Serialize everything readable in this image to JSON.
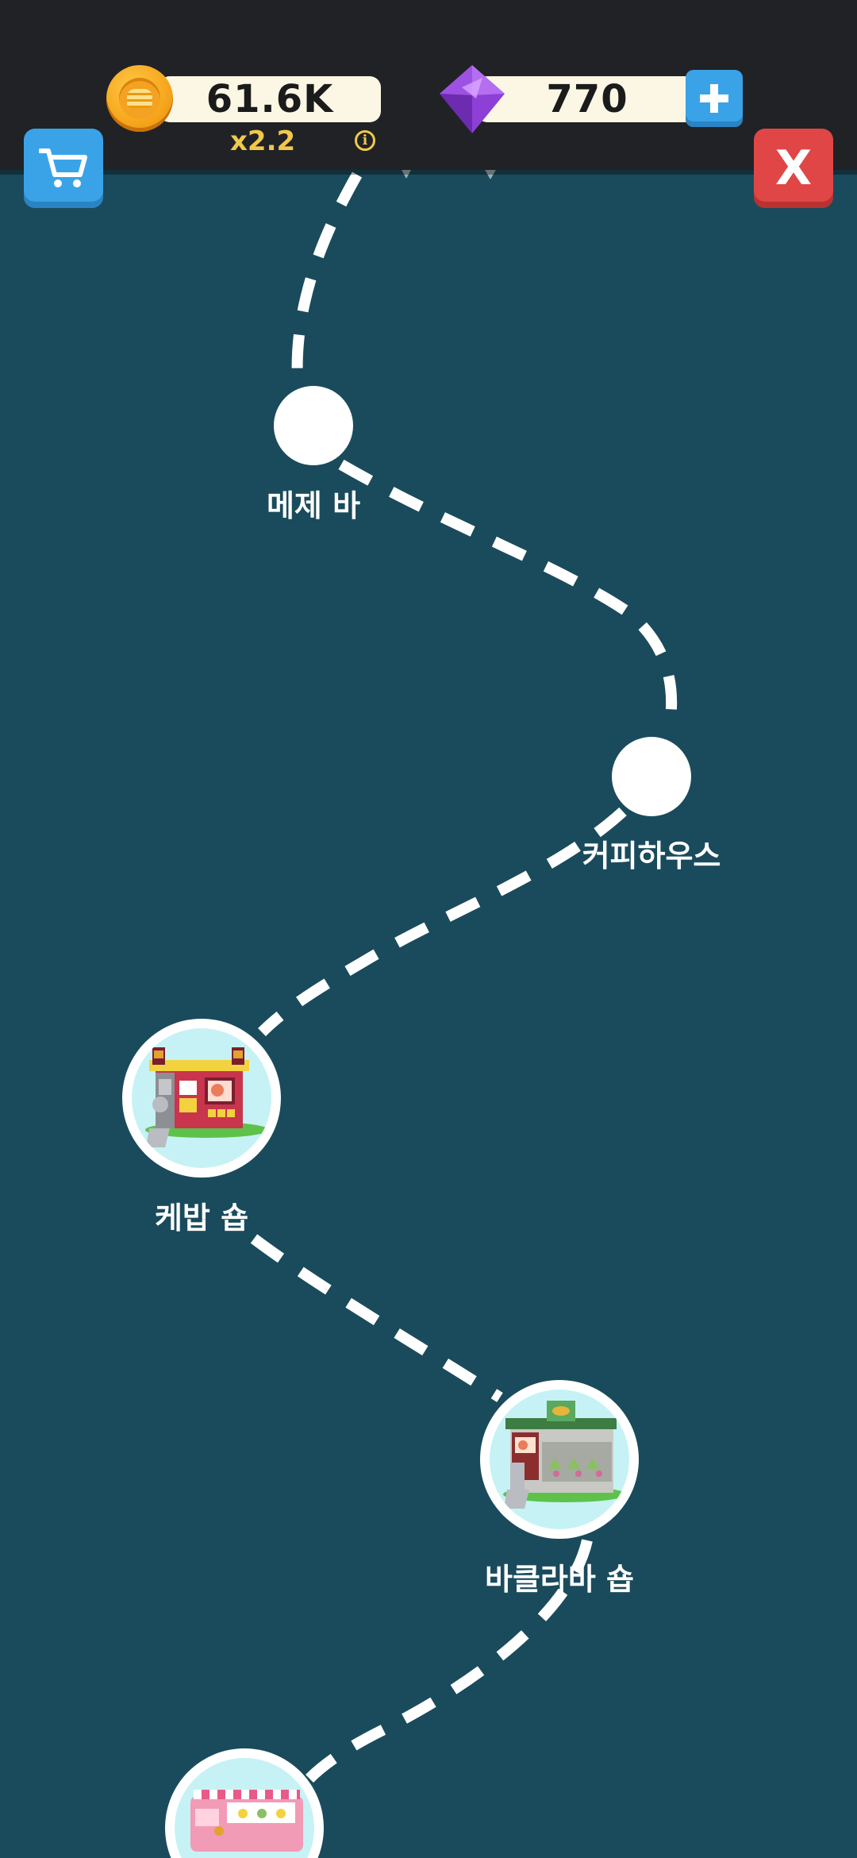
{
  "hud": {
    "coins": "61.6K",
    "multiplier": "x2.2",
    "gems": "770",
    "add_gems_label": "+",
    "close_label": "X",
    "info_label": "i"
  },
  "map": {
    "background_color": "#1a4b5c",
    "stops": [
      {
        "name": "메제 바",
        "unlocked": false
      },
      {
        "name": "커피하우스",
        "unlocked": false
      },
      {
        "name": "케밥 숍",
        "unlocked": true
      },
      {
        "name": "바클라바 숍",
        "unlocked": true
      },
      {
        "name": "",
        "unlocked": true
      }
    ]
  },
  "colors": {
    "accent_blue": "#3aa3e8",
    "close_red": "#e04646",
    "coin_gold": "#f6a51b",
    "gem_purple": "#9b4fe0",
    "multiplier_gold": "#f1c94a"
  },
  "icons": {
    "shop": "cart-icon",
    "coin": "coin-icon",
    "gem": "gem-icon",
    "info": "info-icon"
  }
}
